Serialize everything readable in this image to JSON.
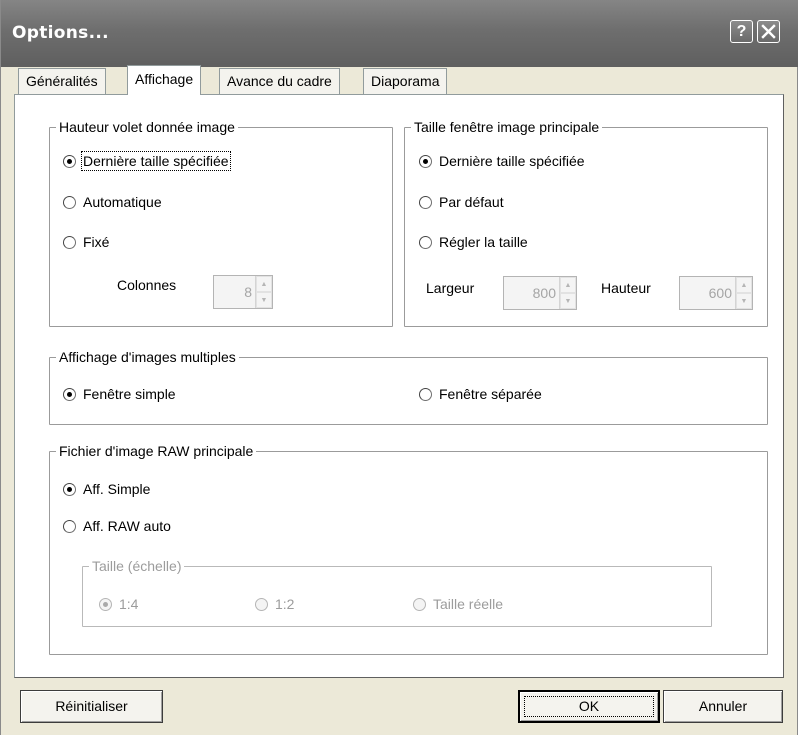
{
  "window": {
    "title": "Options...",
    "help_symbol": "?",
    "close_icon": "close-icon"
  },
  "tabs": [
    {
      "label": "Généralités",
      "active": false
    },
    {
      "label": "Affichage",
      "active": true
    },
    {
      "label": "Avance du cadre",
      "active": false
    },
    {
      "label": "Diaporama",
      "active": false
    }
  ],
  "panel_height": {
    "title": "Hauteur volet donnée image",
    "options": [
      {
        "label": "Dernière taille spécifiée",
        "checked": true,
        "focused": true
      },
      {
        "label": "Automatique",
        "checked": false
      },
      {
        "label": "Fixé",
        "checked": false
      }
    ],
    "columns_label": "Colonnes",
    "columns_value": "8"
  },
  "main_window_size": {
    "title": "Taille fenêtre image principale",
    "options": [
      {
        "label": "Dernière taille spécifiée",
        "checked": true
      },
      {
        "label": "Par défaut",
        "checked": false
      },
      {
        "label": "Régler la taille",
        "checked": false
      }
    ],
    "width_label": "Largeur",
    "width_value": "800",
    "height_label": "Hauteur",
    "height_value": "600"
  },
  "multiple_images": {
    "title": "Affichage d'images multiples",
    "options": [
      {
        "label": "Fenêtre simple",
        "checked": true
      },
      {
        "label": "Fenêtre séparée",
        "checked": false
      }
    ]
  },
  "raw_file": {
    "title": "Fichier d'image RAW principale",
    "options": [
      {
        "label": "Aff. Simple",
        "checked": true
      },
      {
        "label": "Aff. RAW auto",
        "checked": false
      }
    ],
    "scale_group": {
      "title": "Taille (échelle)",
      "enabled": false,
      "options": [
        {
          "label": "1:4",
          "checked": true
        },
        {
          "label": "1:2",
          "checked": false
        },
        {
          "label": "Taille réelle",
          "checked": false
        }
      ]
    }
  },
  "buttons": {
    "reset": "Réinitialiser",
    "ok": "OK",
    "cancel": "Annuler"
  }
}
